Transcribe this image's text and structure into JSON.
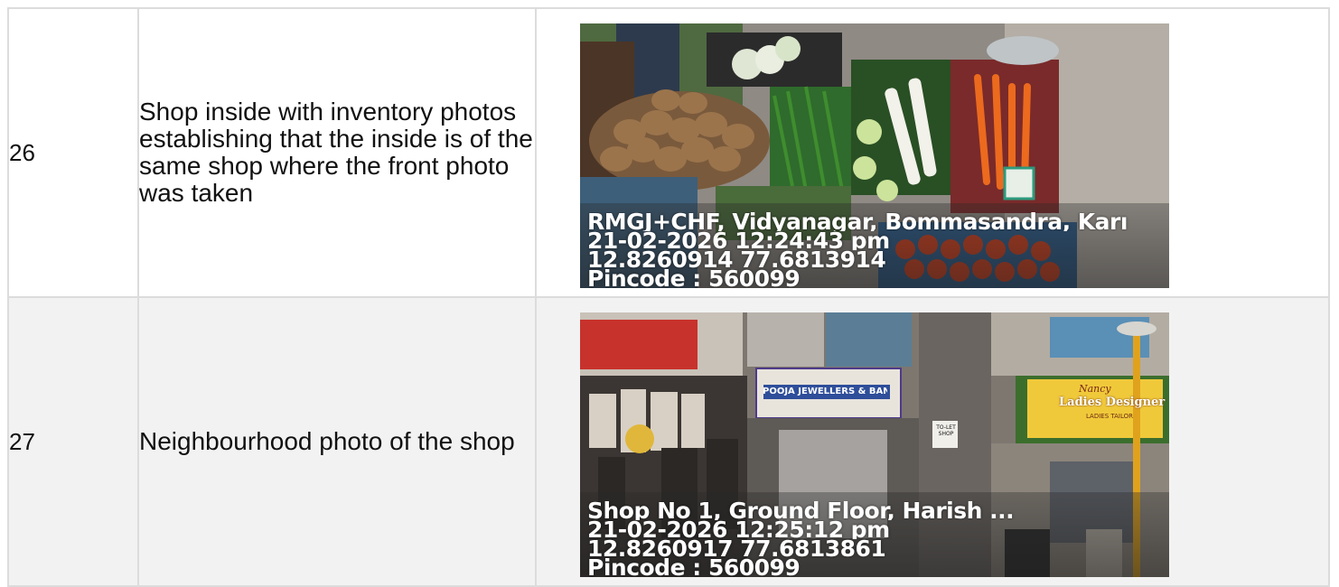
{
  "rows": [
    {
      "number": "26",
      "description": "Shop inside with inventory photos establishing that the inside is of the same shop where the front photo was taken",
      "stamp": {
        "address": "RMGJ+CHF, Vidyanagar, Bommasandra, Karı",
        "datetime": "21-02-2026 12:24:43 pm",
        "coords": "12.8260914 77.6813914",
        "pincode": "Pincode : 560099"
      }
    },
    {
      "number": "27",
      "description": "Neighbourhood photo of the shop",
      "stamp": {
        "address": "Shop No 1, Ground Floor, Harish ...",
        "datetime": "21-02-2026 12:25:12 pm",
        "coords": "12.8260917 77.6813861",
        "pincode": "Pincode : 560099"
      },
      "signs": {
        "jewellers": "POOJA JEWELLERS & BANKERS",
        "nancy": "Nancy",
        "ladies": "Ladies Designer",
        "tailor": "LADIES TAILOR",
        "tolet": "TO-LET SHOP"
      }
    }
  ]
}
